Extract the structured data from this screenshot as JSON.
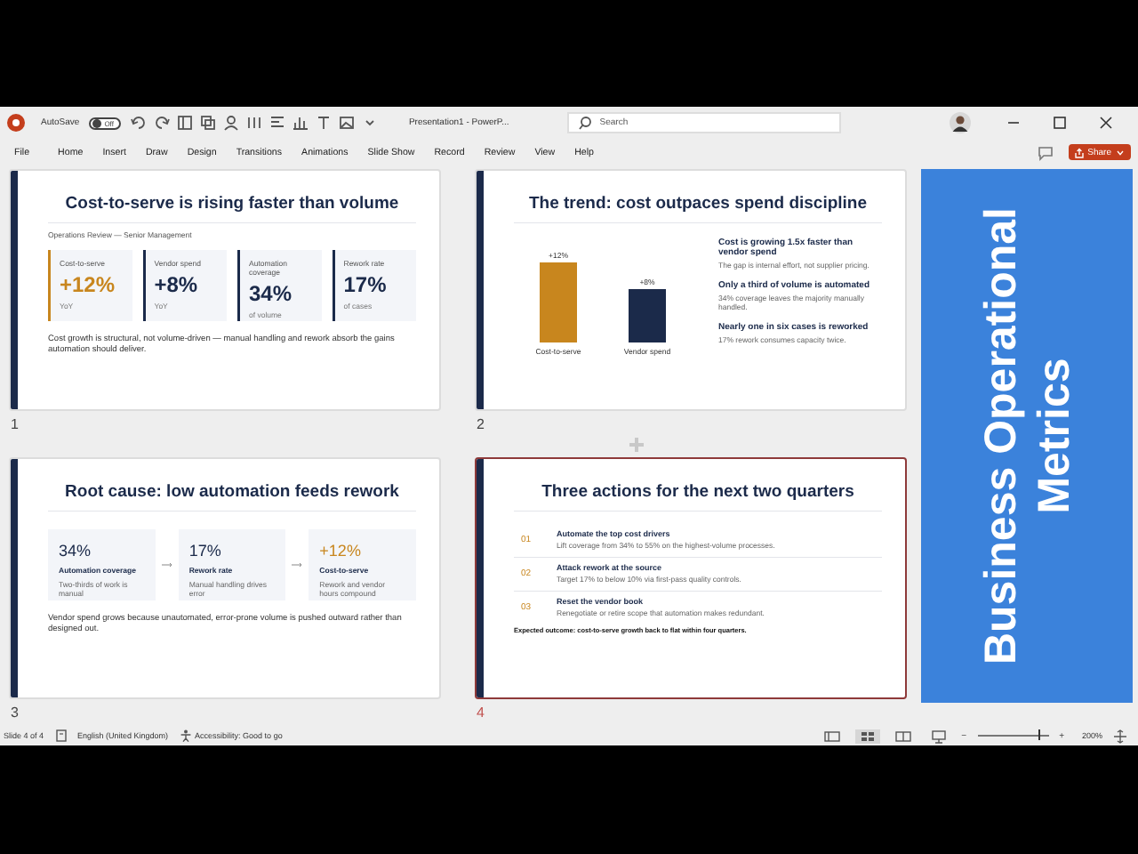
{
  "title_bar": {
    "autosave": {
      "label": "AutoSave",
      "state": "Off",
      "on": false
    },
    "document_title": "Presentation1 - PowerP...",
    "search": {
      "placeholder": "Search"
    }
  },
  "menu": [
    {
      "label": "File"
    },
    {
      "label": "Home"
    },
    {
      "label": "Insert"
    },
    {
      "label": "Draw"
    },
    {
      "label": "Design"
    },
    {
      "label": "Transitions"
    },
    {
      "label": "Animations"
    },
    {
      "label": "Slide Show"
    },
    {
      "label": "Record"
    },
    {
      "label": "Review"
    },
    {
      "label": "View"
    },
    {
      "label": "Help"
    }
  ],
  "share_button": "Share",
  "slides": [
    {
      "number": "1",
      "selected": false,
      "kind": "kpis",
      "title": "Cost-to-serve is rising faster than volume",
      "subtitle": "Operations Review — Senior Management",
      "kpis": [
        {
          "label": "Cost-to-serve",
          "value": "+12%",
          "note": "YoY",
          "color": "#c8861e"
        },
        {
          "label": "Vendor spend",
          "value": "+8%",
          "note": "YoY",
          "color": "#1b2a4a"
        },
        {
          "label": "Automation coverage",
          "value": "34%",
          "note": "of volume",
          "color": "#1b2a4a"
        },
        {
          "label": "Rework rate",
          "value": "17%",
          "note": "of cases",
          "color": "#1b2a4a"
        }
      ],
      "footer": "Cost growth is structural, not volume-driven — manual handling and rework absorb the gains automation should deliver."
    },
    {
      "number": "2",
      "selected": false,
      "kind": "chart",
      "title": "The trend: cost outpaces spend discipline",
      "chart_data": {
        "type": "bar",
        "categories": [
          "Cost-to-serve",
          "Vendor spend"
        ],
        "values": [
          12,
          8
        ],
        "colors": [
          "#c8861e",
          "#1b2a4a"
        ],
        "data_labels": true,
        "value_labels": [
          "+12%",
          "+8%"
        ]
      },
      "points": [
        {
          "heading": "Cost is growing 1.5x faster than vendor spend",
          "text": "The gap is internal effort, not supplier pricing."
        },
        {
          "heading": "Only a third of volume is automated",
          "text": "34% coverage leaves the majority manually handled."
        },
        {
          "heading": "Nearly one in six cases is reworked",
          "text": "17% rework consumes capacity twice."
        }
      ]
    },
    {
      "number": "3",
      "selected": false,
      "kind": "flow",
      "title": "Root cause: low automation feeds rework",
      "steps": [
        {
          "value": "34%",
          "label": "Automation coverage",
          "note": "Two-thirds of work is manual",
          "color": "#1b2a4a"
        },
        {
          "value": "17%",
          "label": "Rework rate",
          "note": "Manual handling drives error",
          "color": "#1b2a4a"
        },
        {
          "value": "+12%",
          "label": "Cost-to-serve",
          "note": "Rework and vendor hours compound",
          "color": "#c8861e"
        }
      ],
      "footer": "Vendor spend grows because unautomated, error-prone volume is pushed outward rather than designed out."
    },
    {
      "number": "4",
      "selected": true,
      "kind": "actions",
      "title": "Three actions for the next two quarters",
      "actions": [
        {
          "number": "01",
          "heading": "Automate the top cost drivers",
          "text": "Lift coverage from 34% to 55% on the highest-volume processes."
        },
        {
          "number": "02",
          "heading": "Attack rework at the source",
          "text": "Target 17% to below 10% via first-pass quality controls."
        },
        {
          "number": "03",
          "heading": "Reset the vendor book",
          "text": "Renegotiate or retire scope that automation makes redundant."
        }
      ],
      "footer": "Expected outcome: cost-to-serve growth back to flat within four quarters."
    }
  ],
  "side_panel": {
    "title": "Business Operational Metrics"
  },
  "status_bar": {
    "slide_info": "Slide 4 of 4",
    "language": "English (United Kingdom)",
    "accessibility": "Accessibility: Good to go",
    "views": [
      {
        "kind": "normal",
        "selected": false
      },
      {
        "kind": "sorter",
        "selected": true
      },
      {
        "kind": "reading",
        "selected": false
      },
      {
        "kind": "presenter",
        "selected": false
      }
    ],
    "zoom_out": "−",
    "zoom_in": "+",
    "zoom_slider": {
      "level": 0.85
    },
    "zoom": "200%"
  }
}
